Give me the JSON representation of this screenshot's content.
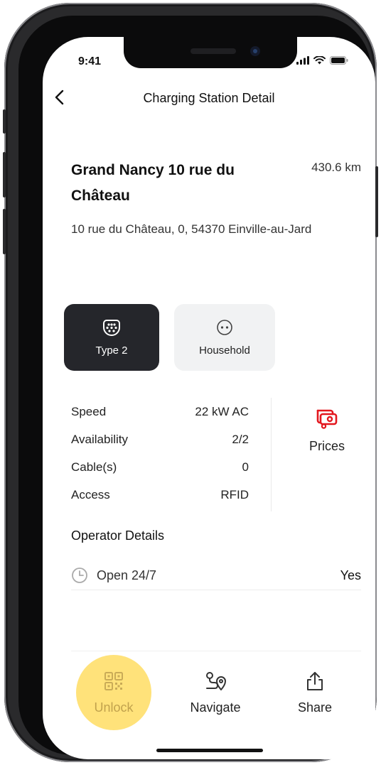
{
  "status_bar": {
    "time": "9:41"
  },
  "header": {
    "title": "Charging Station Detail"
  },
  "station": {
    "name": "Grand Nancy 10 rue du Château",
    "distance": "430.6 km",
    "address": "10 rue du Château, 0, 54370 Einville-au-Jard"
  },
  "connectors": [
    {
      "label": "Type 2",
      "icon": "type2-plug-icon",
      "selected": true
    },
    {
      "label": "Household",
      "icon": "household-plug-icon",
      "selected": false
    }
  ],
  "specs": {
    "speed": {
      "label": "Speed",
      "value": "22 kW AC"
    },
    "availability": {
      "label": "Availability",
      "value": "2/2"
    },
    "cables": {
      "label": "Cable(s)",
      "value": "0"
    },
    "access": {
      "label": "Access",
      "value": "RFID"
    }
  },
  "prices": {
    "label": "Prices",
    "icon": "price-tag-icon",
    "color": "#e3171e"
  },
  "operator": {
    "title": "Operator Details",
    "open_label": "Open 24/7",
    "open_value": "Yes"
  },
  "actions": {
    "unlock": {
      "label": "Unlock",
      "icon": "qr-code-icon",
      "highlight": "#ffe27a"
    },
    "navigate": {
      "label": "Navigate",
      "icon": "route-pin-icon"
    },
    "share": {
      "label": "Share",
      "icon": "share-icon"
    }
  }
}
